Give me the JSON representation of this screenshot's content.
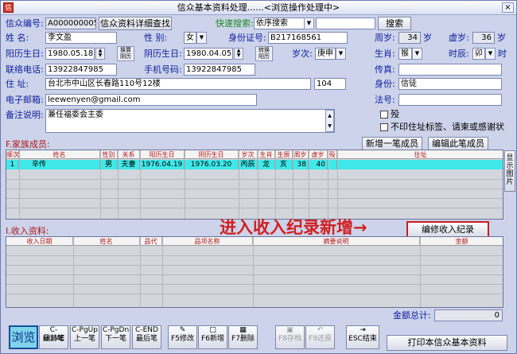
{
  "window": {
    "title": "信众基本资料处理......<浏览操作处理中>",
    "close_label": "×",
    "app_icon": "信"
  },
  "header": {
    "id_label": "信众编号:",
    "id_value": "A000000005",
    "detail_search_button": "信众资料详细查找",
    "quick_search_label": "快速搜索:",
    "quick_search_option": "依序搜索",
    "quick_search_value": "",
    "search_button": "搜索"
  },
  "form": {
    "name_label": "姓    名:",
    "name_value": "李文盈",
    "gender_label": "性    别:",
    "gender_value": "女",
    "idcard_label": "身份证号:",
    "idcard_value": "B217168561",
    "age_label": "周岁:",
    "age_value": "34",
    "age_unit": "岁",
    "xuage_label": "虚岁:",
    "xuage_value": "36",
    "xuage_unit": "岁",
    "solar_label": "阳历生日:",
    "solar_value": "1980.05.18",
    "solar_convert": "换算阴历",
    "lunar_label": "阴历生日:",
    "lunar_value": "1980.04.05",
    "lunar_convert": "转换阳历",
    "year_label": "岁次:",
    "year_value": "庚申",
    "zodiac_label": "生肖:",
    "zodiac_value": "猴",
    "hour_label": "时辰:",
    "hour_value": "卯",
    "hour_unit": "时",
    "phone_label": "联络电话:",
    "phone_value": "13922847985",
    "mobile_label": "手机号码:",
    "mobile_value": "13922847985",
    "fax_label": "传真:",
    "fax_value": "",
    "address_label": "住    址:",
    "address_value": "台北市中山区长春路110号12楼",
    "zip_value": "104",
    "identity_label": "身份:",
    "identity_value": "信徒",
    "email_label": "电子邮箱:",
    "email_value": "leewenyen@gmail.com",
    "dharma_label": "法号:",
    "dharma_value": "",
    "note_label": "备注说明:",
    "note_value": "兼任福委会主委",
    "deceased_label": "殁",
    "noprint_label": "不印住址标签、请柬或感谢状"
  },
  "family": {
    "title": "F.家族成员:",
    "add_button": "新增一笔成员",
    "edit_button": "编辑此笔成员",
    "columns": [
      "顺次",
      "姓名",
      "性别",
      "关系",
      "阳历生日",
      "阴历生日",
      "岁次",
      "生肖",
      "生辰",
      "周岁",
      "虚岁",
      "殁",
      "住址"
    ],
    "rows": [
      {
        "seq": "1",
        "name": "辛传",
        "gender": "男",
        "relation": "夫妻",
        "solar": "1976.04.19",
        "lunar": "1976.03.20",
        "year": "丙辰",
        "zodiac": "龙",
        "hour": "亥",
        "age": "38",
        "xuage": "40",
        "dead": "",
        "addr": ""
      }
    ],
    "show_photo_button": "显示图片"
  },
  "income": {
    "title": "I.收入资料:",
    "annotation": "进入收入纪录新增→",
    "edit_button": "编修收入纪录",
    "columns": [
      "收入日期",
      "姓名",
      "品代",
      "品项名称",
      "摘要说明",
      "金额"
    ],
    "total_label": "金额总计:",
    "total_value": "0"
  },
  "toolbar": {
    "browse": "浏览",
    "first_key": "C-HOME",
    "first_label": "最前笔",
    "prev_key": "C-PgUp",
    "prev_label": "上一笔",
    "next_key": "C-PgDn",
    "next_label": "下一笔",
    "last_key": "C-END",
    "last_label": "最后笔",
    "edit": "F5修改",
    "new": "F6新增",
    "delete": "F7删除",
    "save": "F8存档",
    "restore": "F9还原",
    "close": "ESC结束",
    "print": "打印本信众基本资料"
  },
  "colors": {
    "accent_red": "#d21f1f",
    "highlight_row": "#3fe9ea",
    "label_blue": "#1020a0",
    "label_green": "#1c8a1c"
  }
}
